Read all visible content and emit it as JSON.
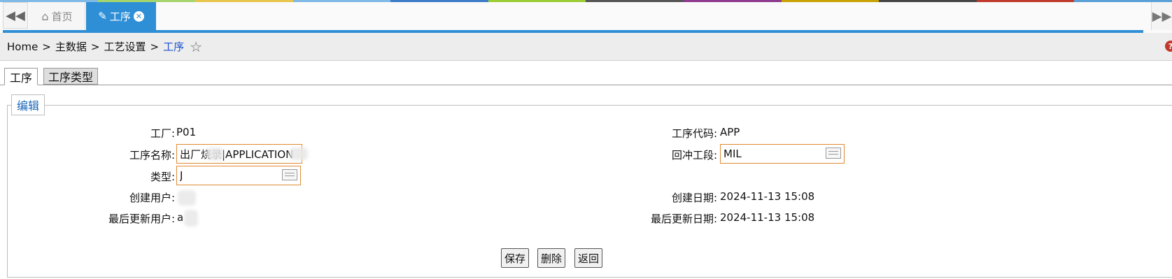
{
  "colors": {
    "accent": "#2f8fd6",
    "input_border": "#e08a32",
    "link": "#1a4fd0",
    "top_stripe": [
      "#7fb9e6",
      "#a6d56c",
      "#e8c54b",
      "#7fb9e6",
      "#3d7cc9",
      "#9acd32",
      "#555555",
      "#8e3a8e",
      "#c8a200",
      "#444444",
      "#c0392b",
      "#5aa0d8"
    ]
  },
  "tabbar": {
    "home_tab": {
      "label": "首页",
      "icon": "home-icon"
    },
    "active_tab": {
      "label": "工序",
      "icon": "edit-icon",
      "close_icon": "close-circle-icon"
    },
    "nav_left_icon": "double-left-arrow-icon",
    "nav_right_icon": "double-right-arrow-icon"
  },
  "breadcrumb": {
    "items": [
      "Home",
      "主数据",
      "工艺设置"
    ],
    "separator": ">",
    "current": "工序",
    "favorite_icon": "star-outline-icon"
  },
  "page_tabs": [
    "工序",
    "工序类型"
  ],
  "form": {
    "legend": "编辑",
    "plant_label": "工厂:",
    "plant_value": "P01",
    "op_code_label": "工序代码:",
    "op_code_value": "APP",
    "op_name_label": "工序名称:",
    "op_name_value": "出厂烧录|APPLICATION",
    "backflush_label": "回冲工段:",
    "backflush_value": "MIL",
    "type_label": "类型:",
    "type_value": "J",
    "created_by_label": "创建用户:",
    "created_date_label": "创建日期:",
    "created_date_value": "2024-11-13 15:08",
    "last_updated_by_label": "最后更新用户:",
    "last_updated_by_value": "a",
    "last_updated_date_label": "最后更新日期:",
    "last_updated_date_value": "2024-11-13 15:08"
  },
  "buttons": {
    "save": "保存",
    "delete": "删除",
    "back": "返回"
  }
}
